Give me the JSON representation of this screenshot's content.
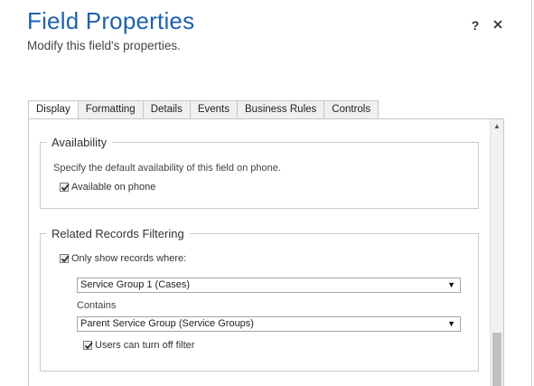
{
  "dialog": {
    "title": "Field Properties",
    "subtitle": "Modify this field's properties.",
    "help_label": "?",
    "close_icon": "close-icon"
  },
  "tabs": [
    {
      "label": "Display",
      "active": true
    },
    {
      "label": "Formatting",
      "active": false
    },
    {
      "label": "Details",
      "active": false
    },
    {
      "label": "Events",
      "active": false
    },
    {
      "label": "Business Rules",
      "active": false
    },
    {
      "label": "Controls",
      "active": false
    }
  ],
  "availability": {
    "legend": "Availability",
    "description": "Specify the default availability of this field on phone.",
    "available_on_phone": {
      "label": "Available on phone",
      "checked": true
    }
  },
  "related_records": {
    "legend": "Related Records Filtering",
    "only_show": {
      "label": "Only show records where:",
      "checked": true
    },
    "first_select": {
      "value": "Service Group 1 (Cases)"
    },
    "contains_label": "Contains",
    "second_select": {
      "value": "Parent Service Group (Service Groups)"
    },
    "users_can_turn_off": {
      "label": "Users can turn off filter",
      "checked": true
    }
  },
  "colors": {
    "title": "#1d62ad",
    "border": "#c6c6c6",
    "inactive_tab": "#f0f0f0"
  }
}
